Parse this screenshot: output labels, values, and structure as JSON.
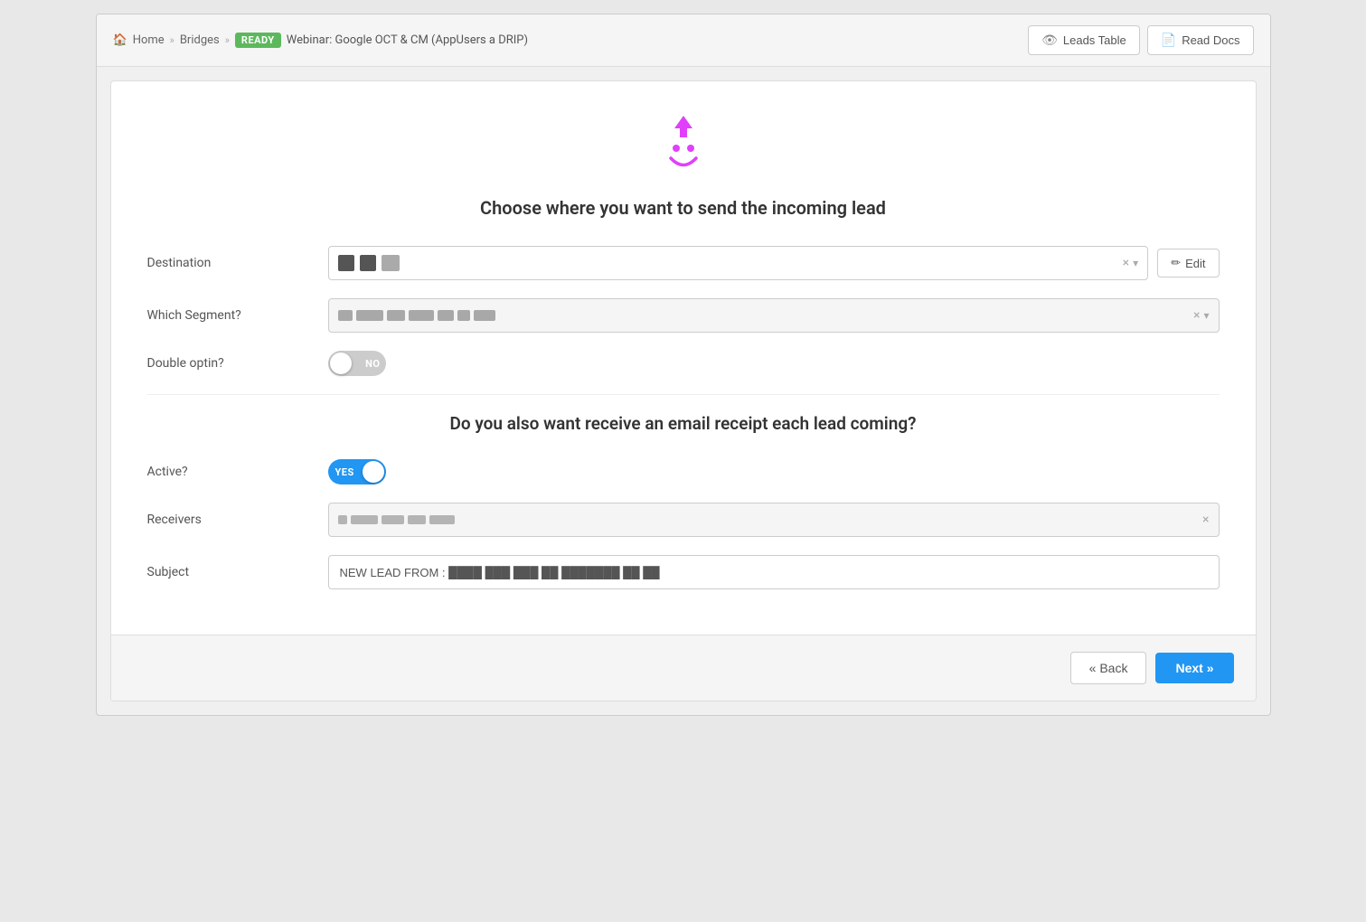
{
  "nav": {
    "home_label": "Home",
    "bridges_label": "Bridges",
    "badge_label": "READY",
    "page_title": "Webinar: Google OCT & CM (AppUsers a DRIP)",
    "leads_table_label": "Leads Table",
    "read_docs_label": "Read Docs"
  },
  "section1": {
    "title": "Choose where you want to send the incoming lead",
    "destination_label": "Destination",
    "edit_button_label": "Edit",
    "segment_label": "Which Segment?",
    "double_optin_label": "Double optin?",
    "toggle_off_label": "NO"
  },
  "section2": {
    "title": "Do you also want receive an email receipt each lead coming?",
    "active_label": "Active?",
    "toggle_on_label": "YES",
    "receivers_label": "Receivers",
    "subject_label": "Subject",
    "subject_value": "NEW LEAD FROM :"
  },
  "footer": {
    "back_label": "« Back",
    "next_label": "Next »"
  }
}
